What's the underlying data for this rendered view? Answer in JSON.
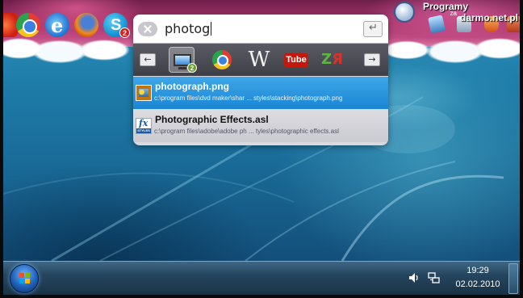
{
  "watermark": {
    "line1": "Programy",
    "connector": "za",
    "line2": "darmo.net.pl"
  },
  "dock": {
    "skype_badge": "2"
  },
  "launcher": {
    "search_query": "photog",
    "nav_prev": "←",
    "nav_next": "→",
    "plugins": [
      {
        "name": "computer",
        "badge": "2",
        "selected": true
      },
      {
        "name": "chrome"
      },
      {
        "name": "wikipedia",
        "label": "W"
      },
      {
        "name": "youtube",
        "label": "Tube"
      },
      {
        "name": "translate",
        "label_z": "Z",
        "label_r": "Я"
      }
    ],
    "results": [
      {
        "title": "photograph.png",
        "path": "c:\\program files\\dvd maker\\shar ... styles\\stacking\\photograph.png",
        "icon": "image-file-icon",
        "selected": true
      },
      {
        "title": "Photographic Effects.asl",
        "path": "c:\\program files\\adobe\\adobe ph ... tyles\\photographic effects.asl",
        "icon": "styles-file-icon",
        "icon_text_fx": "fx",
        "icon_text_styles": "STYLES"
      }
    ]
  },
  "taskbar": {
    "clock_time": "19:29",
    "clock_date": "02.02.2010"
  },
  "colors": {
    "selection": "#1a86d4",
    "taskbar": "#25455e",
    "wallpaper": "#1d7aa6"
  }
}
